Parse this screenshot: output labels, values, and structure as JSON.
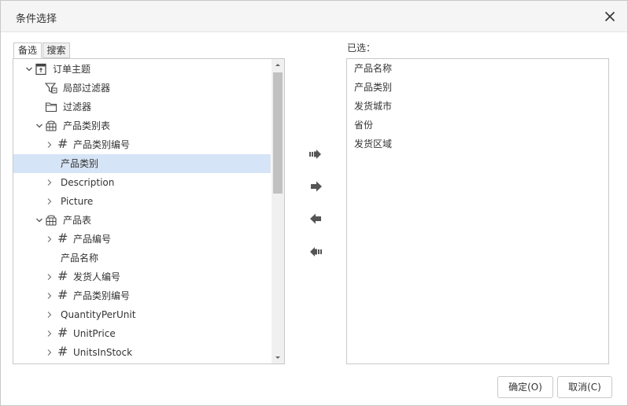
{
  "dialog": {
    "title": "条件选择",
    "tabs": [
      {
        "label": "备选",
        "active": true
      },
      {
        "label": "搜索",
        "active": false
      }
    ]
  },
  "tree": {
    "items": [
      {
        "label": "订单主题",
        "level": 0,
        "chevron": "down",
        "icon": "subject-icon"
      },
      {
        "label": "局部过滤器",
        "level": 1,
        "chevron": "none",
        "icon": "local-filter-icon"
      },
      {
        "label": "过滤器",
        "level": 1,
        "chevron": "none",
        "icon": "folder-icon"
      },
      {
        "label": "产品类别表",
        "level": 1,
        "chevron": "down",
        "icon": "table-icon"
      },
      {
        "label": "产品类别编号",
        "level": 2,
        "chevron": "right",
        "icon": "hash-icon"
      },
      {
        "label": "产品类别",
        "level": 2,
        "chevron": "none",
        "icon": "none",
        "selected": true
      },
      {
        "label": "Description",
        "level": 2,
        "chevron": "right",
        "icon": "none"
      },
      {
        "label": "Picture",
        "level": 2,
        "chevron": "right",
        "icon": "none"
      },
      {
        "label": "产品表",
        "level": 1,
        "chevron": "down",
        "icon": "table-icon"
      },
      {
        "label": "产品编号",
        "level": 2,
        "chevron": "right",
        "icon": "hash-icon"
      },
      {
        "label": "产品名称",
        "level": 2,
        "chevron": "none",
        "icon": "none"
      },
      {
        "label": "发货人编号",
        "level": 2,
        "chevron": "right",
        "icon": "hash-icon"
      },
      {
        "label": "产品类别编号",
        "level": 2,
        "chevron": "right",
        "icon": "hash-icon"
      },
      {
        "label": "QuantityPerUnit",
        "level": 2,
        "chevron": "right",
        "icon": "none"
      },
      {
        "label": "UnitPrice",
        "level": 2,
        "chevron": "right",
        "icon": "hash-icon"
      },
      {
        "label": "UnitsInStock",
        "level": 2,
        "chevron": "right",
        "icon": "hash-icon"
      }
    ]
  },
  "selected": {
    "label": "已选：",
    "items": [
      "产品名称",
      "产品类别",
      "发货城市",
      "省份",
      "发货区域"
    ]
  },
  "buttons": {
    "ok": "确定(O)",
    "cancel": "取消(C)"
  },
  "colors": {
    "selection": "#d6e4f7",
    "arrow": "#555555",
    "border": "#c9c9c9"
  }
}
